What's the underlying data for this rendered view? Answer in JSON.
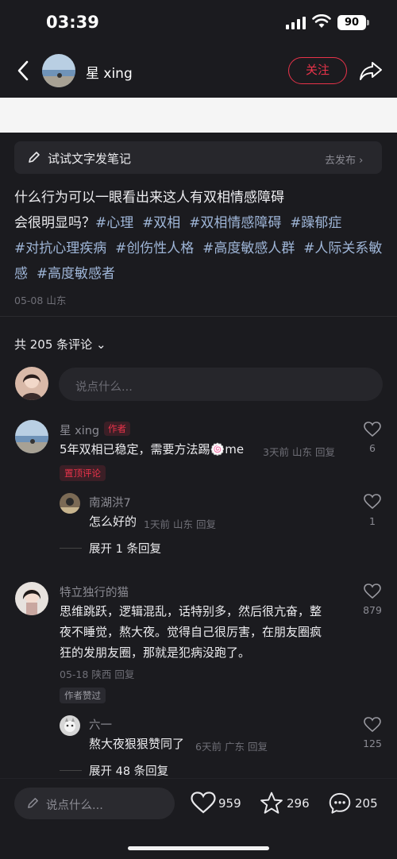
{
  "status": {
    "time": "03:39",
    "battery": "90"
  },
  "header": {
    "author": "星 xing",
    "follow_label": "关注"
  },
  "try_note": {
    "label": "试试文字发笔记",
    "action": "去发布"
  },
  "post": {
    "text_line1": "什么行为可以一眼看出来这人有双相情感障碍",
    "text_line2_prefix": "会很明显吗？",
    "tags": [
      "#心理",
      "#双相",
      "#双相情感障碍",
      "#躁郁症",
      "#对抗心理疾病",
      "#创伤性人格",
      "#高度敏感人群",
      "#人际关系敏感",
      "#高度敏感者"
    ],
    "date": "05-08",
    "location": "山东"
  },
  "comments_header": {
    "count_label": "共 205 条评论"
  },
  "input": {
    "placeholder": "说点什么..."
  },
  "comments": [
    {
      "name": "星 xing",
      "author_badge": "作者",
      "text": "5年双相已稳定，需要方法踢🍥me",
      "time": "3天前",
      "location": "山东",
      "reply": "回复",
      "pin_badge": "置顶评论",
      "likes": "6",
      "replies": [
        {
          "name": "南湖洪7",
          "text": "怎么好的",
          "time": "1天前",
          "location": "山东",
          "reply": "回复",
          "likes": "1"
        }
      ],
      "expand": "展开 1 条回复"
    },
    {
      "name": "特立独行的猫",
      "text_line1": "思维跳跃，逻辑混乱，话特别多，然后很亢奋，整",
      "text_line2": "夜不睡觉，熬大夜。觉得自己很厉害，在朋友圈疯",
      "text_line3": "狂的发朋友圈，那就是犯病没跑了。",
      "time": "05-18",
      "location": "陕西",
      "reply": "回复",
      "liked_badge": "作者赞过",
      "likes": "879",
      "replies": [
        {
          "name": "六一",
          "text": "熬大夜狠狠赞同了",
          "time": "6天前",
          "location": "广东",
          "reply": "回复",
          "likes": "125"
        }
      ],
      "expand": "展开 48 条回复"
    }
  ],
  "bottom": {
    "placeholder": "说点什么...",
    "likes": "959",
    "collects": "296",
    "comments": "205"
  },
  "colors": {
    "accent": "#e8334a",
    "tag": "#9fb6d8",
    "background": "#1b1b1f"
  }
}
